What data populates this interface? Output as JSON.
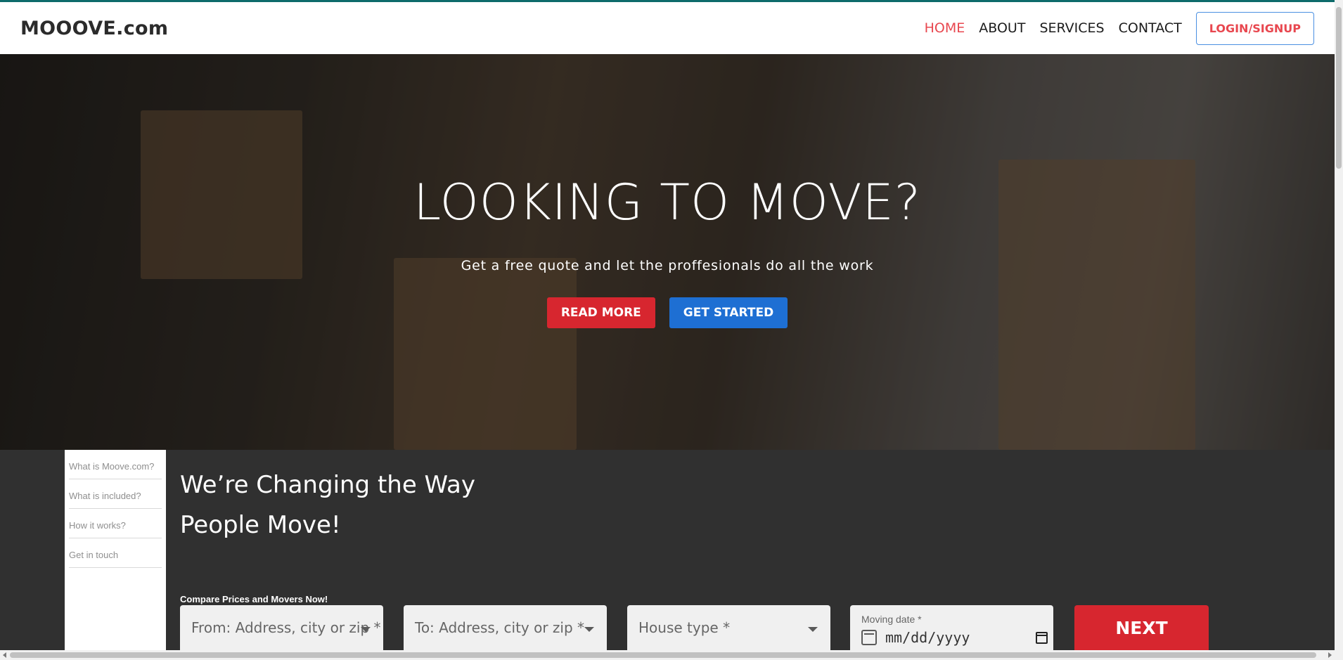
{
  "navbar": {
    "brand": "MOOOVE.com",
    "links": [
      {
        "label": "HOME",
        "active": true
      },
      {
        "label": "ABOUT",
        "active": false
      },
      {
        "label": "SERVICES",
        "active": false
      },
      {
        "label": "CONTACT",
        "active": false
      }
    ],
    "login_label": "LOGIN/SIGNUP"
  },
  "hero": {
    "title": "LOOKING TO MOVE?",
    "subtitle": "Get a free quote and let the proffesionals do all the work",
    "read_more": "READ MORE",
    "get_started": "GET STARTED"
  },
  "sidenav": {
    "items": [
      {
        "label": "What is Moove.com?"
      },
      {
        "label": "What is included?"
      },
      {
        "label": "How it works?"
      },
      {
        "label": "Get in touch"
      }
    ]
  },
  "section": {
    "heading_line1": "We’re Changing the Way",
    "heading_line2": "People Move!",
    "compare_label": "Compare Prices and Movers Now!"
  },
  "form": {
    "from_placeholder": "From: Address, city or zip *",
    "to_placeholder": "To: Address, city or zip *",
    "house_type_placeholder": "House type *",
    "moving_date_label": "Moving date *",
    "moving_date_value": "mm/dd/yyyy",
    "next_label": "NEXT"
  },
  "colors": {
    "accent_red": "#d7262f",
    "accent_blue": "#1e6fd3",
    "active_nav": "#e8474f",
    "dark_section": "#303030"
  }
}
